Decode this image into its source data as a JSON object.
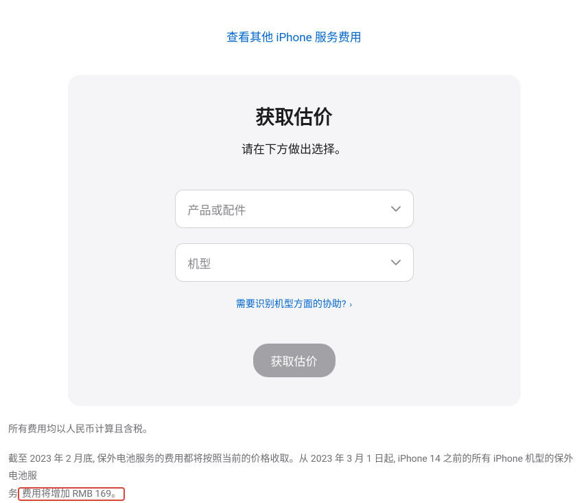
{
  "topLink": {
    "label": "查看其他 iPhone 服务费用"
  },
  "card": {
    "title": "获取估价",
    "subtitle": "请在下方做出选择。",
    "select1": {
      "placeholder": "产品或配件"
    },
    "select2": {
      "placeholder": "机型"
    },
    "helpLink": {
      "label": "需要识别机型方面的协助?"
    },
    "button": {
      "label": "获取估价"
    }
  },
  "footer": {
    "line1": "所有费用均以人民币计算且含税。",
    "line2_a": "截至 2023 年 2 月底, 保外电池服务的费用都将按照当前的价格收取。从 2023 年 3 月 1 日起, iPhone 14 之前的所有 iPhone 机型的保外电池服",
    "line2_b": "务",
    "line2_highlight": "费用将增加 RMB 169。"
  }
}
